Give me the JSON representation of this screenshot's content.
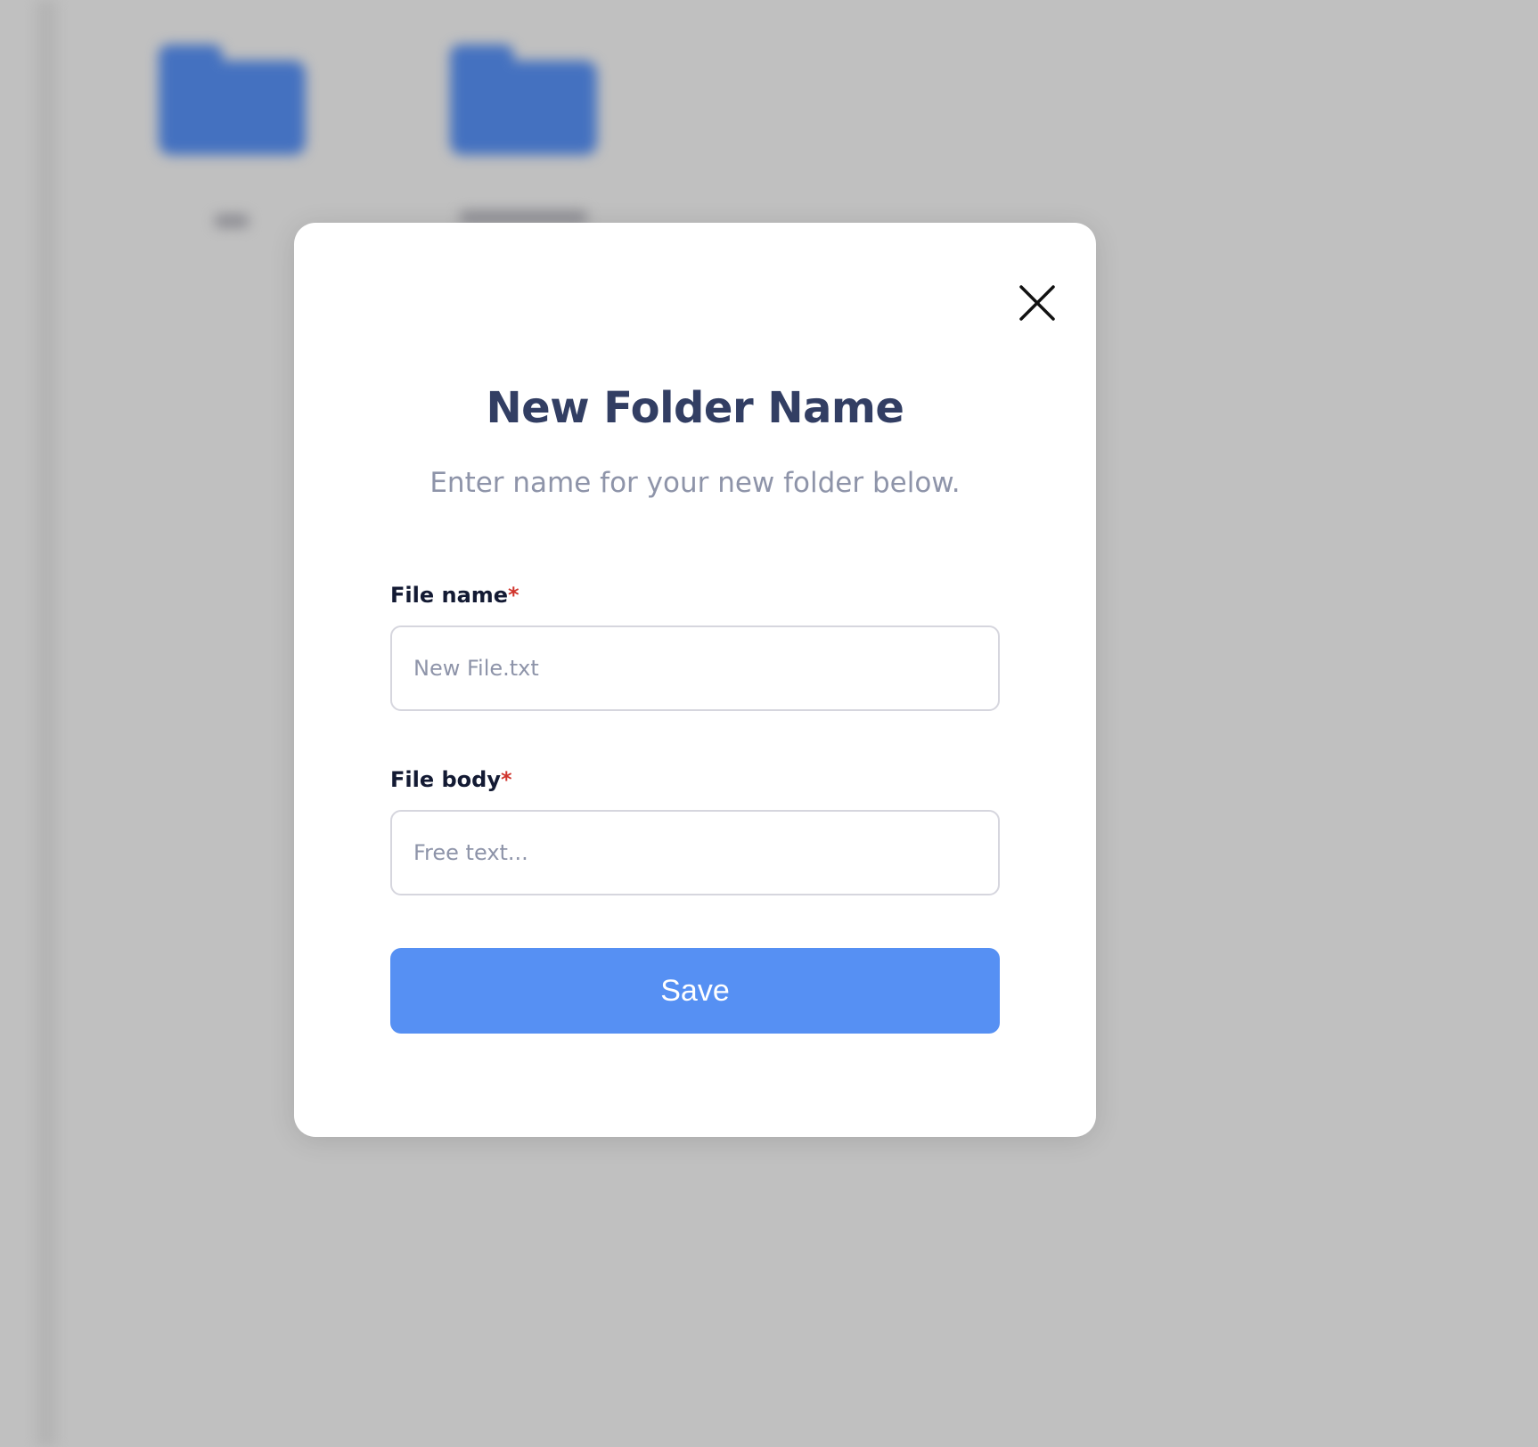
{
  "colors": {
    "backdrop": "#c0c0c0",
    "folder": "#4471c0",
    "title": "#323e63",
    "muted": "#8e94a9",
    "required": "#d0342c",
    "accent": "#5690f3"
  },
  "background": {
    "folders": [
      {
        "icon": "folder-icon"
      },
      {
        "icon": "folder-icon"
      }
    ]
  },
  "modal": {
    "close_icon": "close-icon",
    "title": "New Folder Name",
    "subtitle": "Enter name for your new folder below.",
    "fields": [
      {
        "label": "File name",
        "required_mark": "*",
        "placeholder": "New File.txt",
        "value": ""
      },
      {
        "label": "File body",
        "required_mark": "*",
        "placeholder": "Free text...",
        "value": ""
      }
    ],
    "save_label": "Save"
  }
}
